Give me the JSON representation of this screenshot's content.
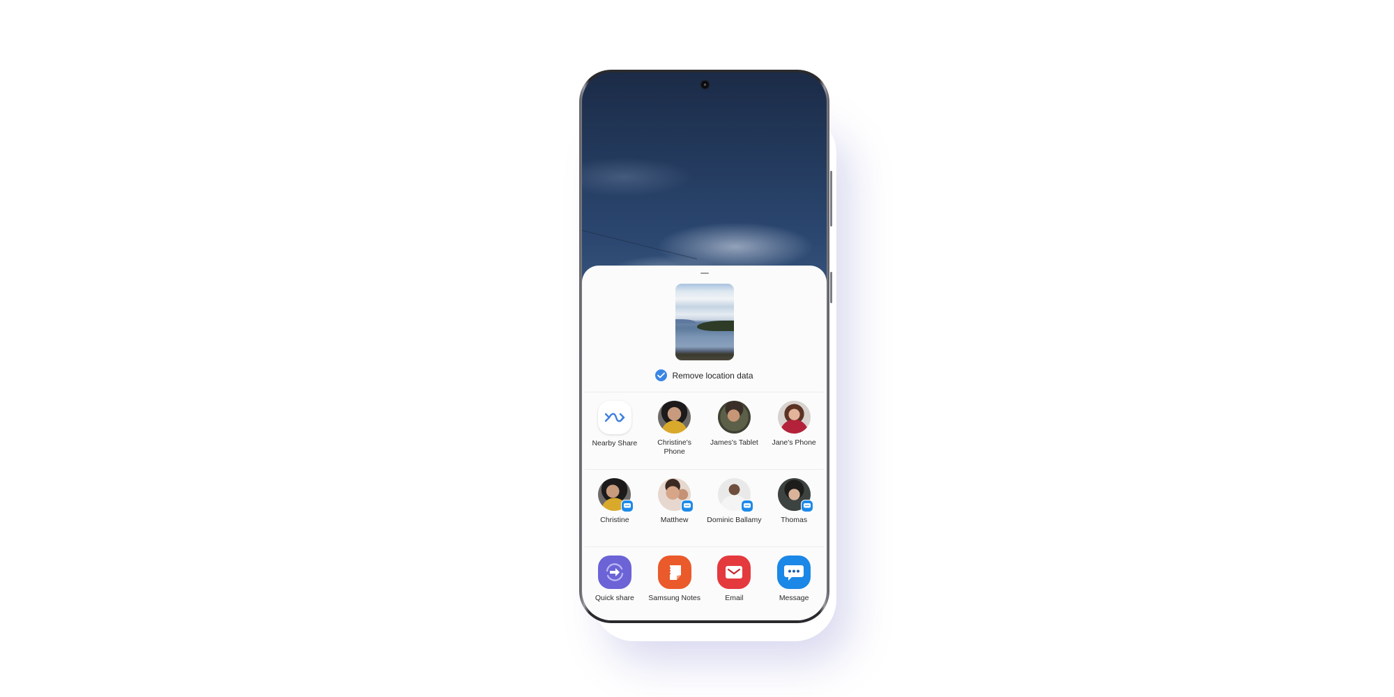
{
  "share_sheet": {
    "remove_location_label": "Remove location data",
    "remove_location_checked": true,
    "thumbnail_description": "landscape photo of lake and hill",
    "nearby_devices": [
      {
        "label": "Nearby Share",
        "type": "nearby-share",
        "icon": "nearby-share-icon"
      },
      {
        "label": "Christine's Phone",
        "type": "device",
        "avatar": "christine-avatar"
      },
      {
        "label": "James's Tablet",
        "type": "device",
        "avatar": "james-avatar"
      },
      {
        "label": "Jane's Phone",
        "type": "device",
        "avatar": "jane-avatar"
      }
    ],
    "contacts": [
      {
        "label": "Christine",
        "avatar": "christine-avatar",
        "badge": "message-badge-icon"
      },
      {
        "label": "Matthew",
        "avatar": "matthew-avatar",
        "badge": "message-badge-icon"
      },
      {
        "label": "Dominic Ballamy",
        "avatar": "dominic-avatar",
        "badge": "message-badge-icon"
      },
      {
        "label": "Thomas",
        "avatar": "thomas-avatar",
        "badge": "message-badge-icon"
      }
    ],
    "apps": [
      {
        "label": "Quick share",
        "icon": "quick-share-icon",
        "color": "#6b63d6"
      },
      {
        "label": "Samsung Notes",
        "icon": "samsung-notes-icon",
        "color": "#ea5a2b"
      },
      {
        "label": "Email",
        "icon": "email-icon",
        "color": "#e43a3e"
      },
      {
        "label": "Message",
        "icon": "message-icon",
        "color": "#1b87e6"
      }
    ]
  },
  "colors": {
    "accent": "#3a86e6",
    "message_badge": "#1f8ae8"
  }
}
